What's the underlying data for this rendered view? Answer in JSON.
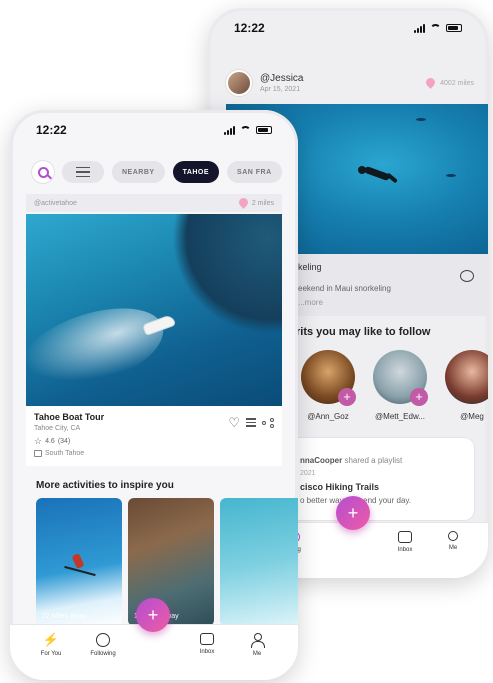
{
  "back_phone": {
    "status_time": "12:22",
    "post": {
      "username": "@Jessica",
      "date": "Apr 15, 2021",
      "distance": "4002 miles",
      "caption_title": "keling",
      "caption_text": "eekend in Maui snorkeling",
      "caption_more": "...more"
    },
    "section_title": "rits you may like to follow",
    "people": [
      {
        "handle": "@Ann_Goz"
      },
      {
        "handle": "@Mett_Edw..."
      },
      {
        "handle": "@Meg"
      }
    ],
    "playlist": {
      "user": "nnaCooper",
      "action": "shared a playlist",
      "date": "2021",
      "title": "cisco Hiking Trails",
      "desc": "o better way to spend your day."
    },
    "tabs": [
      {
        "label": "owing"
      },
      {
        "label": "Inbox"
      },
      {
        "label": "Me"
      }
    ],
    "fab": "+"
  },
  "front_phone": {
    "status_time": "12:22",
    "filters": {
      "chips": [
        "NEARBY",
        "TAHOE",
        "SAN FRA"
      ],
      "active_index": 1
    },
    "post": {
      "handle": "@activetahoe",
      "distance": "2 miles",
      "title": "Tahoe Boat Tour",
      "location": "Tahoe City, CA",
      "rating": "4.6",
      "reviews": "(34)",
      "area": "South Tahoe"
    },
    "section_title": "More activities to inspire you",
    "cards": [
      {
        "caption": "22 Miles Away"
      },
      {
        "caption": "18 Miles Away"
      },
      {
        "caption": ""
      }
    ],
    "tabs": [
      {
        "label": "For You"
      },
      {
        "label": "Following"
      },
      {
        "label": "Inbox"
      },
      {
        "label": "Me"
      }
    ],
    "fab": "+"
  },
  "colors": {
    "accent": "#b24fd1",
    "accent_pink": "#f05aa6",
    "active_chip": "#14142a"
  },
  "icons": [
    "search-icon",
    "filter-icon",
    "location-pin-icon",
    "heart-icon",
    "list-icon",
    "share-icon",
    "star-icon",
    "calendar-icon",
    "chat-icon",
    "bolt-icon",
    "following-icon",
    "inbox-icon",
    "me-icon",
    "plus-icon"
  ]
}
